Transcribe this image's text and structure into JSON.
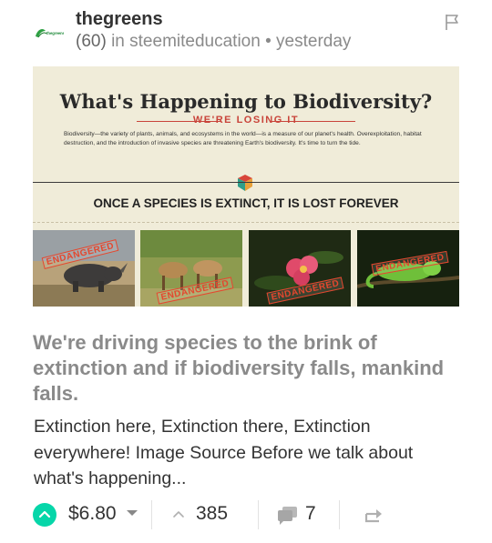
{
  "post": {
    "author": "thegreens",
    "reputation": "(60)",
    "community_prefix": "in",
    "community": "steemiteducation",
    "separator": "•",
    "time": "yesterday",
    "avatar_text": "thegreens",
    "title": "We're driving species to the brink of extinction and if biodiversity falls, mankind falls.",
    "excerpt": "Extinction here, Extinction there, Extinction everywhere! Image Source Before we talk about what's happening..."
  },
  "thumbnail": {
    "title": "What's Happening to Biodiversity?",
    "subtitle": "WE'RE LOSING IT",
    "body": "Biodiversity—the variety of plants, animals, and ecosystems in the world—is a measure of our planet's health. Overexploitation, habitat destruction, and the introduction of invasive species are threatening Earth's biodiversity. It's time to turn the tide.",
    "banner": "ONCE A SPECIES IS EXTINCT, IT IS LOST FOREVER",
    "stamp": "ENDANGERED"
  },
  "footer": {
    "payout": "$6.80",
    "votes": "385",
    "comments": "7"
  },
  "colors": {
    "upvote": "#06d6a9",
    "stamp": "#e4472e",
    "title_gray": "#8a8a8a"
  },
  "icons": {
    "flag": "flag-icon",
    "upvote": "chevron-up-icon",
    "payout_caret": "caret-down-icon",
    "votes": "chevron-up-icon",
    "comments": "comments-icon",
    "reblog": "reblog-icon"
  }
}
